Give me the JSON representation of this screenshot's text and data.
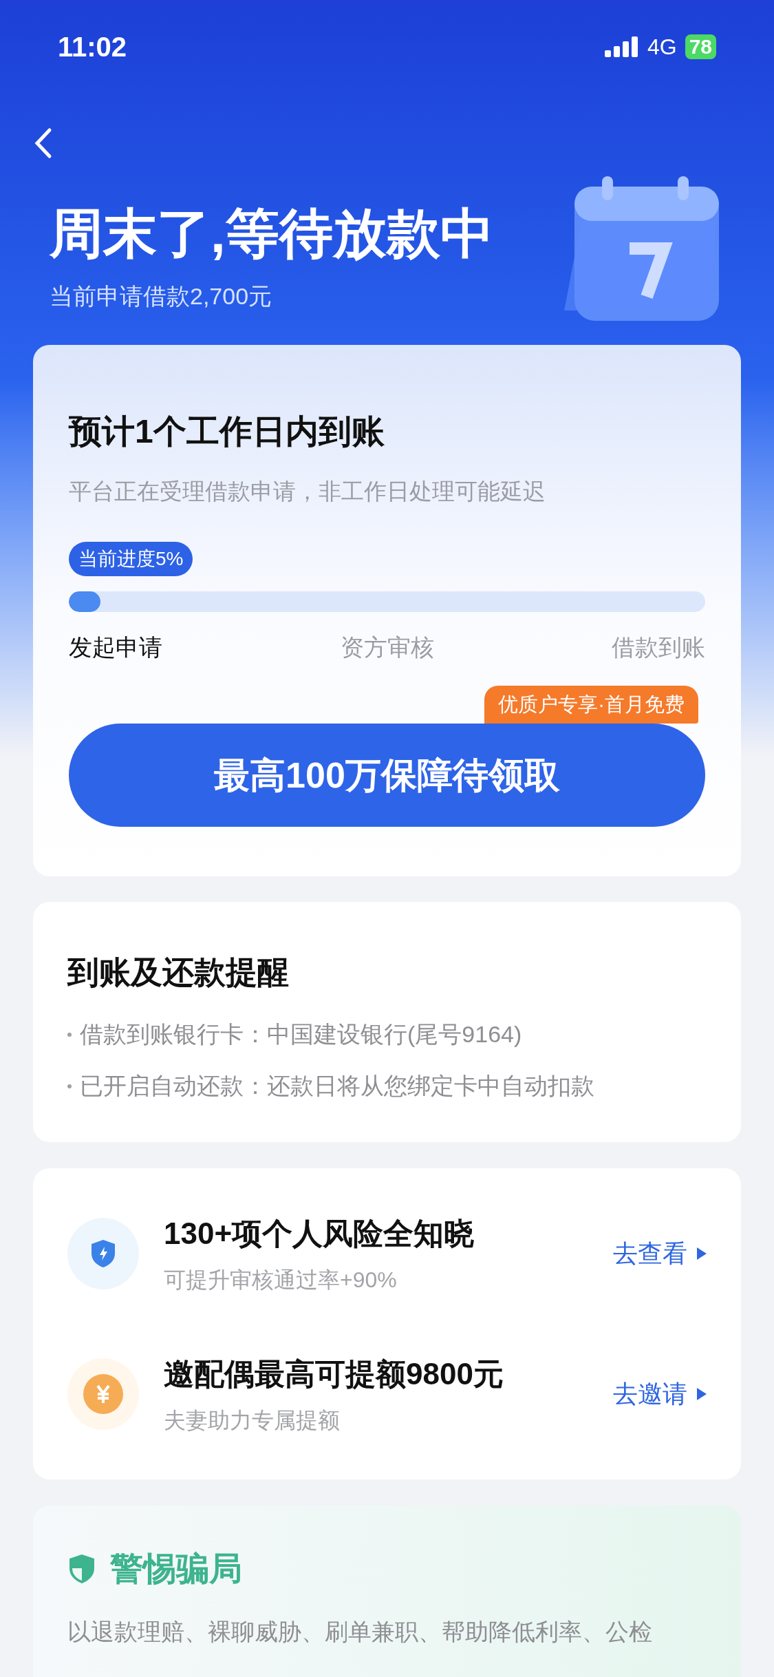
{
  "status_bar": {
    "time": "11:02",
    "network": "4G",
    "battery": "78"
  },
  "header": {
    "title": "周末了,等待放款中",
    "subtitle": "当前申请借款2,700元"
  },
  "progress_card": {
    "title": "预计1个工作日内到账",
    "description": "平台正在受理借款申请，非工作日处理可能延迟",
    "progress_label": "当前进度5%",
    "level": 0.05,
    "stages": [
      {
        "label": "发起申请",
        "reached": true
      },
      {
        "label": "资方审核",
        "reached": false
      },
      {
        "label": "借款到账",
        "reached": false
      }
    ],
    "cta": {
      "label": "最高100万保障待领取",
      "tag": "优质户专享·首月免费"
    }
  },
  "reminder_card": {
    "title": "到账及还款提醒",
    "items": [
      "借款到账银行卡：中国建设银行(尾号9164)",
      "已开启自动还款：还款日将从您绑定卡中自动扣款"
    ]
  },
  "offers": [
    {
      "kind": "shield",
      "title": "130+项个人风险全知晓",
      "subtitle": "可提升审核通过率+90%",
      "action": "去查看"
    },
    {
      "kind": "coin",
      "title": "邀配偶最高可提额9800元",
      "subtitle": "夫妻助力专属提额",
      "action": "去邀请"
    }
  ],
  "fraud_card": {
    "title": "警惕骗局",
    "text": "以退款理赔、裸聊威胁、刷单兼职、帮助降低利率、公检"
  }
}
